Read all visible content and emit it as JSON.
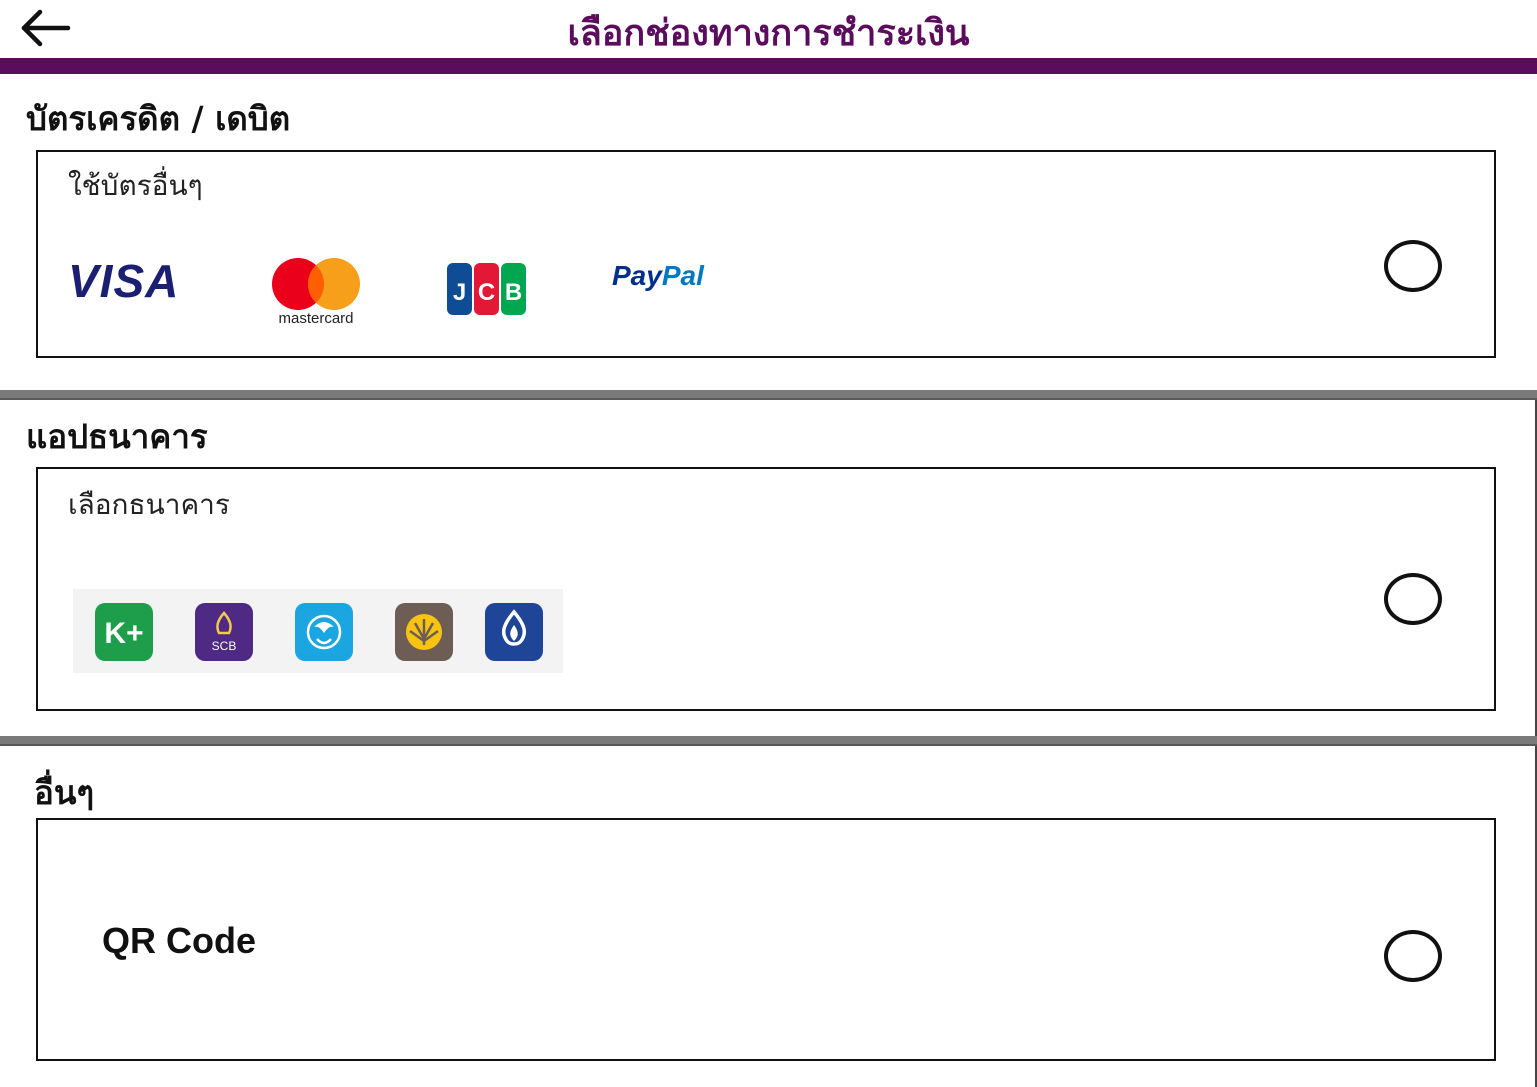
{
  "header": {
    "title": "เลือกช่องทางการชำระเงิน",
    "accent_color": "#5b0c5d",
    "back_icon": "arrow-left-icon"
  },
  "sections": {
    "card": {
      "title": "บัตรเครดิต / เดบิต",
      "option_label": "ใช้บัตรอื่นๆ",
      "logos": {
        "visa": "VISA",
        "mastercard": "mastercard",
        "jcb": "JCB",
        "paypal_pay": "Pay",
        "paypal_pal": "Pal"
      }
    },
    "bank": {
      "title": "แอปธนาคาร",
      "option_label": "เลือกธนาคาร",
      "banks": [
        {
          "name": "kplus",
          "text": "K+",
          "color": "#1e9e4a"
        },
        {
          "name": "scb",
          "text": "SCB",
          "color": "#4e2a84"
        },
        {
          "name": "krungthai",
          "text": "",
          "color": "#1ba5e1"
        },
        {
          "name": "krungsri",
          "text": "",
          "color": "#6d5d55"
        },
        {
          "name": "bangkok-bank",
          "text": "",
          "color": "#1e4598"
        }
      ]
    },
    "other": {
      "title": "อื่นๆ",
      "option_label": "QR Code"
    }
  }
}
